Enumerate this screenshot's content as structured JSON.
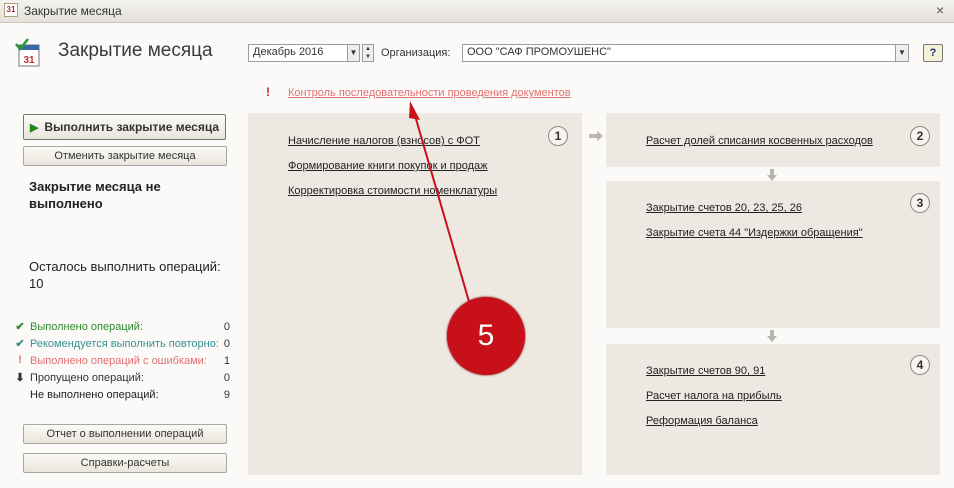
{
  "window": {
    "title": "Закрытие месяца",
    "close_glyph": "×",
    "icon_text": "31"
  },
  "header": {
    "title": "Закрытие месяца",
    "period_value": "Декабрь 2016",
    "org_label": "Организация:",
    "org_value": "ООО \"САФ ПРОМОУШЕНС\"",
    "help_label": "?"
  },
  "check": {
    "mark": "!",
    "link_text": "Контроль последовательности проведения документов"
  },
  "left": {
    "run_button": "Выполнить закрытие месяца",
    "cancel_button": "Отменить закрытие месяца",
    "status_heading": "Закрытие месяца не выполнено",
    "remaining_text": "Осталось выполнить операций: 10",
    "stats": [
      {
        "icon": "✔",
        "label": "Выполнено операций:",
        "count": "0",
        "color": "#2d8a2d"
      },
      {
        "icon": "✔",
        "label": "Рекомендуется выполнить повторно:",
        "count": "0",
        "color": "#3a9090"
      },
      {
        "icon": "!",
        "label": "Выполнено операций с ошибками:",
        "count": "1",
        "color": "#e07070"
      },
      {
        "icon": "⬇",
        "label": "Пропущено операций:",
        "count": "0",
        "color": "#333333"
      },
      {
        "icon": "",
        "label": "Не выполнено операций:",
        "count": "9",
        "color": "#222222"
      }
    ],
    "report_button": "Отчет о выполнении операций",
    "ref_button": "Справки-расчеты"
  },
  "stages": [
    {
      "number": "1",
      "operations": [
        "Начисление налогов (взносов) с ФОТ",
        "Формирование книги покупок и продаж",
        "Корректировка стоимости номенклатуры"
      ]
    },
    {
      "number": "2",
      "operations": [
        "Расчет долей списания косвенных расходов"
      ]
    },
    {
      "number": "3",
      "operations": [
        "Закрытие счетов 20, 23, 25, 26",
        "Закрытие счета 44 \"Издержки обращения\""
      ]
    },
    {
      "number": "4",
      "operations": [
        "Закрытие счетов 90, 91",
        "Расчет налога на прибыль",
        "Реформация баланса"
      ]
    }
  ],
  "annotation": {
    "label": "5",
    "color": "#c8101a"
  }
}
